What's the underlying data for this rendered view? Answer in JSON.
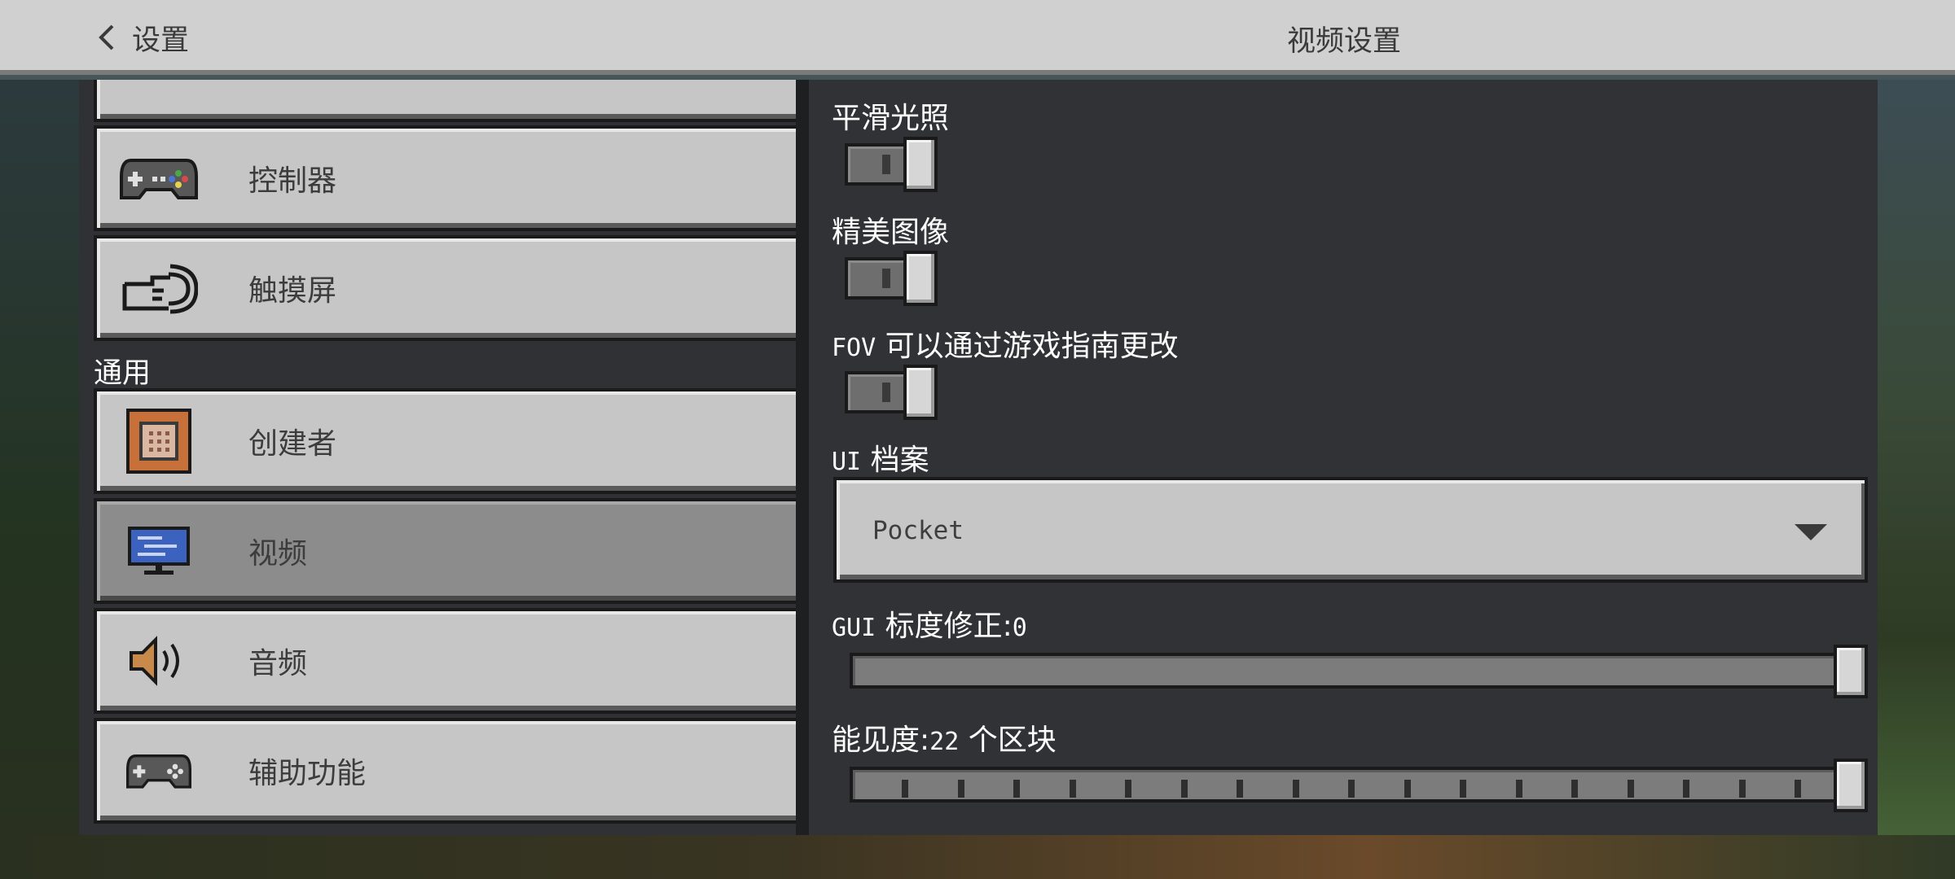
{
  "header": {
    "back_label": "设置",
    "title": "视频设置"
  },
  "sidebar": {
    "section_general": "通用",
    "items": [
      {
        "label": "控制器",
        "icon": "controller-icon"
      },
      {
        "label": "触摸屏",
        "icon": "touch-icon"
      },
      {
        "label": "创建者",
        "icon": "command-block-icon"
      },
      {
        "label": "视频",
        "icon": "monitor-icon",
        "selected": true
      },
      {
        "label": "音频",
        "icon": "speaker-icon"
      },
      {
        "label": "辅助功能",
        "icon": "controller-icon"
      }
    ]
  },
  "settings": {
    "smooth_lighting": {
      "label": "平滑光照",
      "enabled": true
    },
    "fancy_graphics": {
      "label": "精美图像",
      "enabled": true
    },
    "fov": {
      "label_prefix": "FOV",
      "label_rest": "可以通过游戏指南更改",
      "enabled": true
    },
    "ui_profile": {
      "label_prefix": "UI",
      "label_rest": "档案",
      "value": "Pocket"
    },
    "gui_scale": {
      "label_prefix": "GUI",
      "label_rest": "标度修正:",
      "value_text": "0",
      "position": 1.0
    },
    "render_distance": {
      "label_prefix": "能见度:",
      "value_text": "22",
      "label_suffix": "个区块",
      "position": 1.0
    }
  },
  "colors": {
    "panel_bg": "#313235",
    "button_bg": "#c6c6c6",
    "button_selected_bg": "#8c8c8c"
  }
}
